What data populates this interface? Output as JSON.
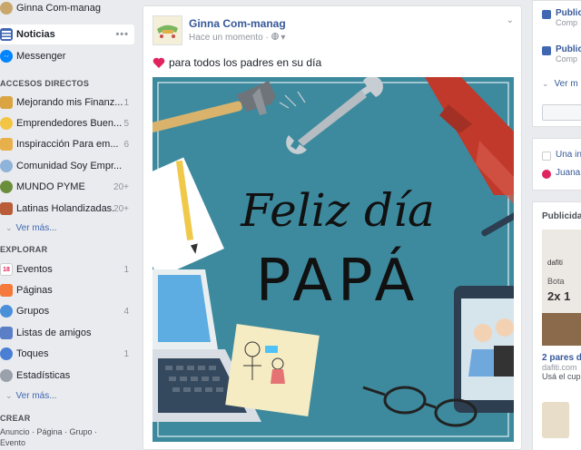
{
  "sidebar": {
    "profile_label": "Ginna Com-manag",
    "news_label": "Noticias",
    "news_more": "•••",
    "messenger_label": "Messenger",
    "shortcuts_title": "ACCESOS DIRECTOS",
    "shortcuts": [
      {
        "label": "Mejorando mis Finanz...",
        "count": "1"
      },
      {
        "label": "Emprendedores Buen...",
        "count": "5"
      },
      {
        "label": "Inspiracción Para em...",
        "count": "6"
      },
      {
        "label": "Comunidad Soy Empr...",
        "count": ""
      },
      {
        "label": "MUNDO PYME",
        "count": "20+"
      },
      {
        "label": "Latinas Holandizadas...",
        "count": "20+"
      }
    ],
    "see_more_1": "Ver más...",
    "explore_title": "EXPLORAR",
    "explore": [
      {
        "label": "Eventos",
        "count": "1",
        "icon_text": "18"
      },
      {
        "label": "Páginas",
        "count": ""
      },
      {
        "label": "Grupos",
        "count": "4"
      },
      {
        "label": "Listas de amigos",
        "count": ""
      },
      {
        "label": "Toques",
        "count": "1"
      },
      {
        "label": "Estadísticas",
        "count": ""
      }
    ],
    "see_more_2": "Ver más...",
    "create_title": "CREAR",
    "create_line1": "Anuncio · Página · Grupo ·",
    "create_line2": "Evento"
  },
  "post": {
    "author": "Ginna Com-manag",
    "timestamp": "Hace un momento",
    "text": "para todos los padres en su día",
    "image_line1": "Feliz día",
    "image_line2": "PAPÁ"
  },
  "right": {
    "pub1_title": "Publicid",
    "pub1_sub": "Comp",
    "pub2_title": "Publici",
    "pub2_sub": "Comp",
    "more_label": "Ver m",
    "event1": "Una in",
    "event2": "Juana",
    "ads_title": "Publicida",
    "ad_brand": "dafiti",
    "ad_text1": "Bota",
    "ad_text2": "2x 1",
    "ad_link": "2 pares d",
    "ad_domain": "dafiti.com",
    "ad_desc": "Usá el cup"
  },
  "colors": {
    "brand_blue": "#4267b2",
    "link_blue": "#365899",
    "image_bg": "#3d8a9e",
    "heart": "#e0245e"
  },
  "icons": [
    "search-icon",
    "globe-icon",
    "heart-icon",
    "chevron-down-icon",
    "calendar-icon",
    "flag-icon",
    "group-icon",
    "list-icon",
    "hand-icon",
    "chart-icon"
  ]
}
